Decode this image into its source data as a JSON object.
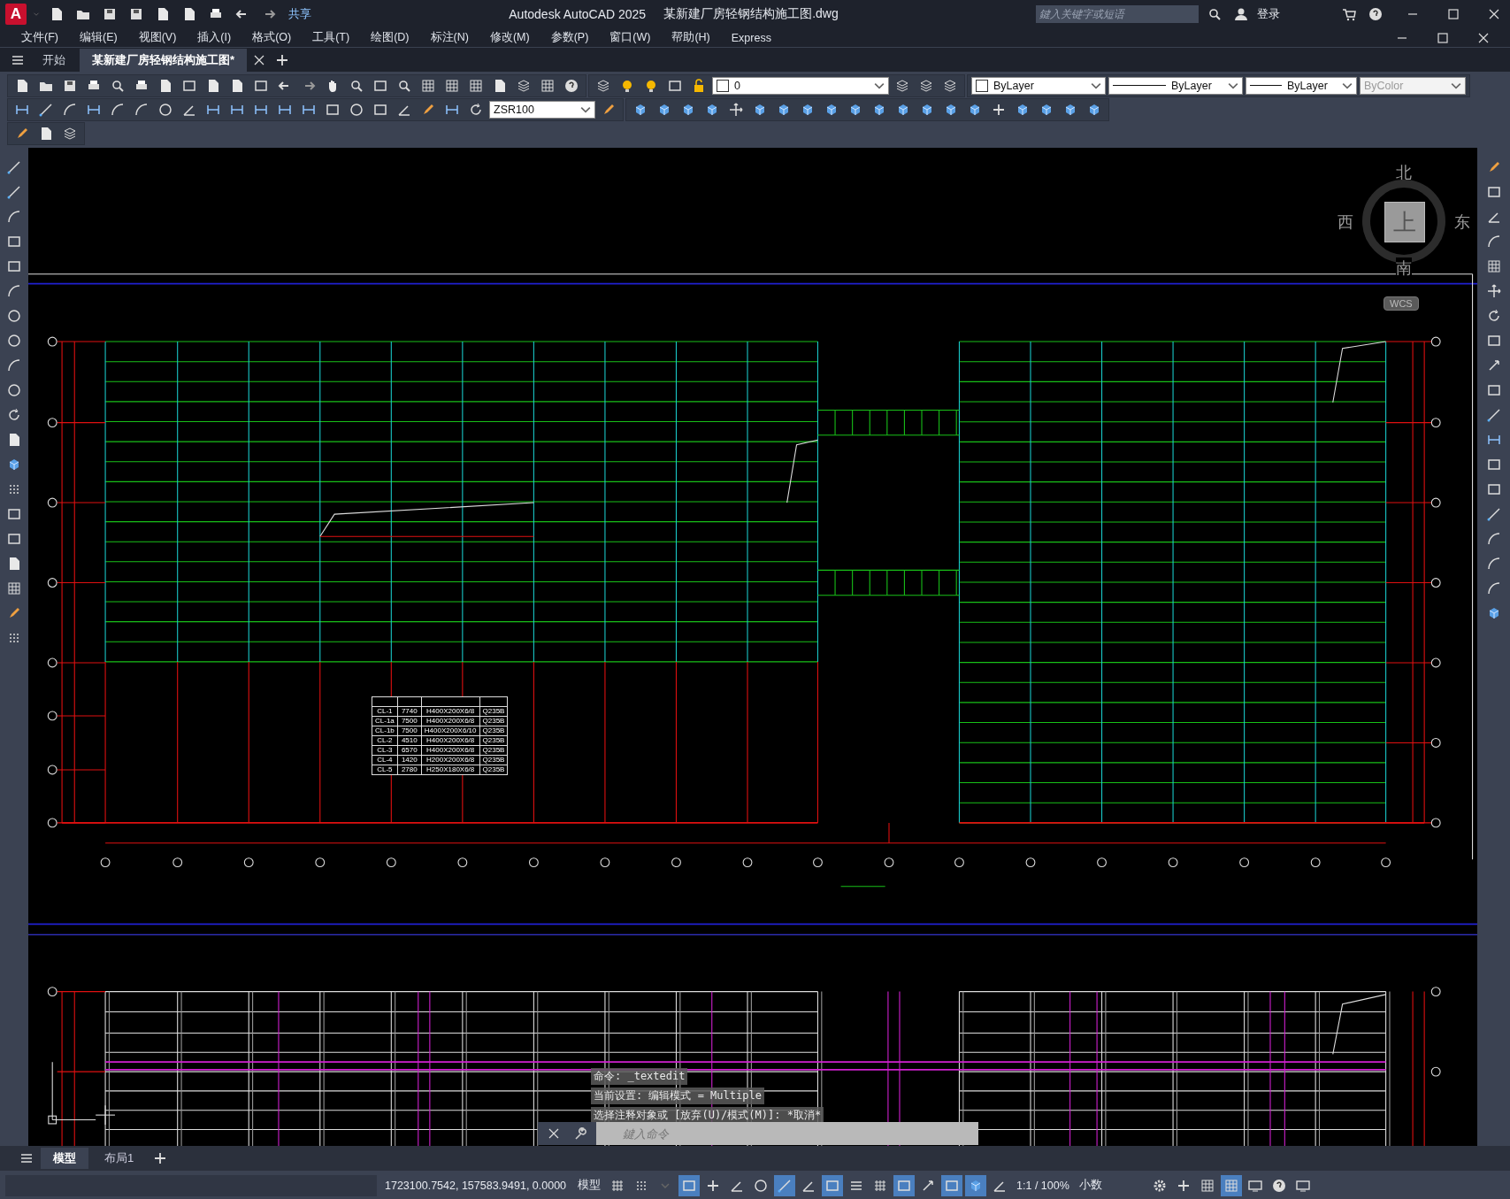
{
  "title_bar": {
    "logo": "A",
    "share": "共享",
    "app_title": "Autodesk AutoCAD 2025",
    "file_name": "某新建厂房轻钢结构施工图.dwg",
    "search": {
      "placeholder": "鍵入关键字或短语"
    },
    "login": "登录"
  },
  "menu": [
    "文件(F)",
    "编辑(E)",
    "视图(V)",
    "插入(I)",
    "格式(O)",
    "工具(T)",
    "绘图(D)",
    "标注(N)",
    "修改(M)",
    "参数(P)",
    "窗口(W)",
    "帮助(H)",
    "Express"
  ],
  "doc_tabs": [
    {
      "label": "开始",
      "selected": false
    },
    {
      "label": "某新建厂房轻钢结构施工图*",
      "selected": true
    }
  ],
  "properties": {
    "layer": "0",
    "dim_style": "ZSR100",
    "color_control": "ByLayer",
    "linetype": "ByLayer",
    "lineweight": "ByLayer",
    "plot_style": {
      "value": "ByColor",
      "disabled": true
    }
  },
  "viewcube": {
    "north": "北",
    "south": "南",
    "west": "西",
    "east": "东",
    "face": "上",
    "ucs": "WCS"
  },
  "purlin_table": {
    "rows": [
      [
        "CL-1",
        "7740",
        "H400X200X6/8",
        "Q235B"
      ],
      [
        "CL-1a",
        "7500",
        "H400X200X6/8",
        "Q235B"
      ],
      [
        "CL-1b",
        "7500",
        "H400X200X6/10",
        "Q235B"
      ],
      [
        "CL-2",
        "4510",
        "H400X200X6/8",
        "Q235B"
      ],
      [
        "CL-3",
        "6570",
        "H400X200X6/8",
        "Q235B"
      ],
      [
        "CL-4",
        "1420",
        "H200X200X6/8",
        "Q235B"
      ],
      [
        "CL-5",
        "2780",
        "H250X180X6/8",
        "Q235B"
      ]
    ]
  },
  "command_history": [
    "命令: _textedit",
    "当前设置: 编辑模式 = Multiple",
    "选择注释对象或 [放弃(U)/模式(M)]: *取消*"
  ],
  "command_input": {
    "placeholder": "鍵入命令"
  },
  "layout_tabs": [
    {
      "label": "模型",
      "selected": true
    },
    {
      "label": "布局1",
      "selected": false
    }
  ],
  "status_bar": {
    "coordinates": "1723100.7542, 157583.9491, 0.0000",
    "space": "模型",
    "toggles": [
      {
        "on": false
      },
      {
        "on": false
      },
      {
        "on": false
      },
      {
        "on": true
      },
      {
        "on": false
      },
      {
        "on": false
      },
      {
        "on": false
      },
      {
        "on": true
      },
      {
        "on": false
      },
      {
        "on": true
      },
      {
        "on": false
      },
      {
        "on": false
      },
      {
        "on": true
      },
      {
        "on": false
      },
      {
        "on": true
      },
      {
        "on": true
      },
      {
        "on": false
      }
    ],
    "scale": "1:1 / 100%",
    "units": "小数",
    "end_toggles": [
      {
        "on": false
      },
      {
        "on": false
      },
      {
        "on": false
      },
      {
        "on": true
      },
      {
        "on": false
      },
      {
        "on": false
      },
      {
        "on": false
      }
    ]
  }
}
